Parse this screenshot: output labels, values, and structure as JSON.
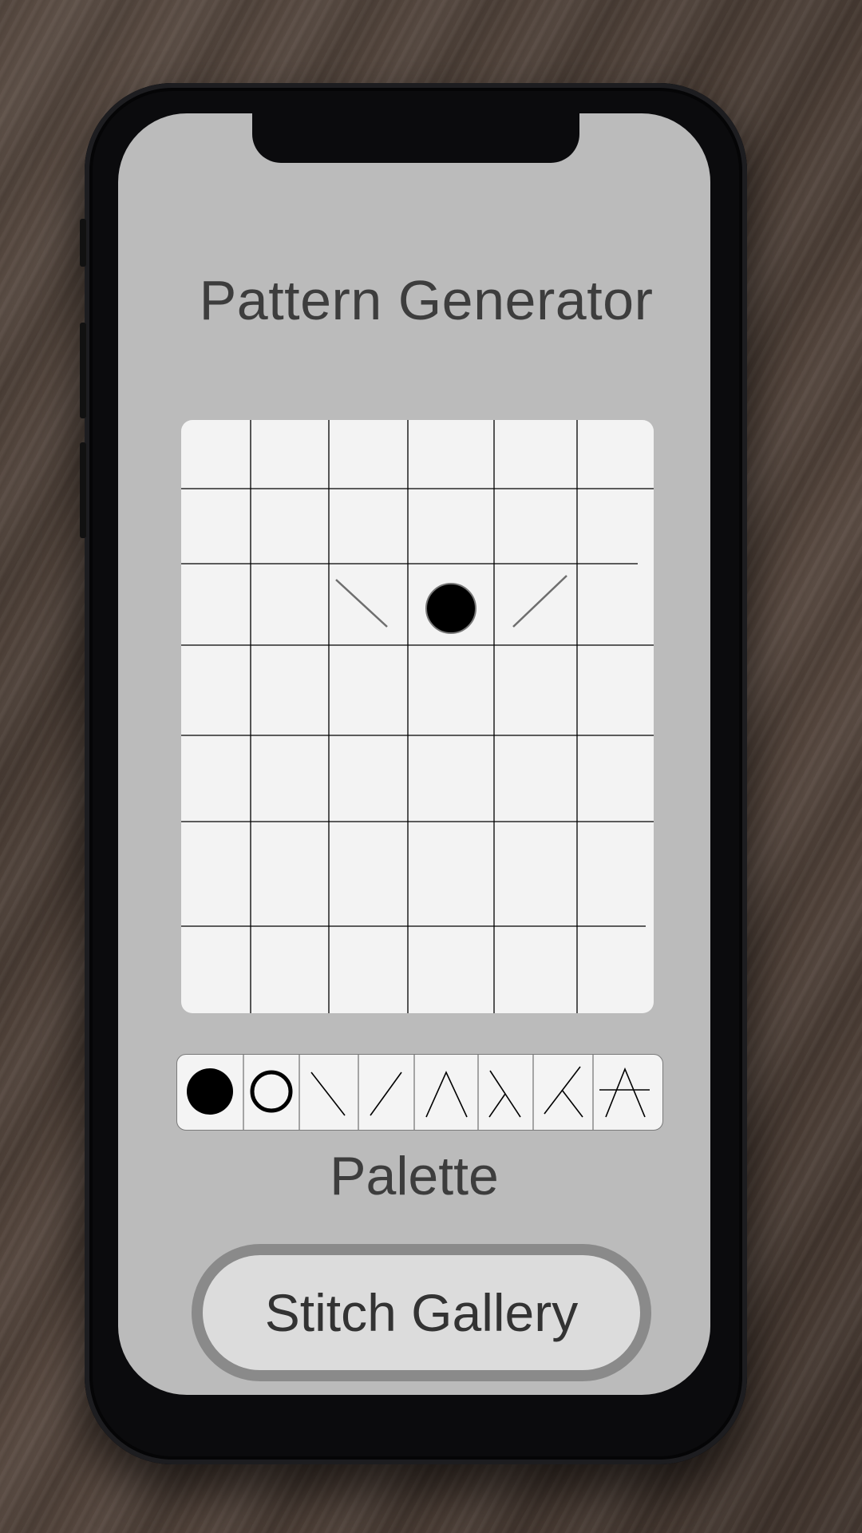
{
  "app": {
    "title": "Pattern Generator"
  },
  "pattern_grid": {
    "columns": 6,
    "rows": 7,
    "symbols": [
      {
        "row": 3,
        "col": 3,
        "symbol": "backslash-stitch-icon"
      },
      {
        "row": 3,
        "col": 4,
        "symbol": "filled-circle-icon"
      },
      {
        "row": 3,
        "col": 5,
        "symbol": "slash-stitch-icon"
      }
    ]
  },
  "palette": {
    "label": "Palette",
    "items": [
      {
        "name": "filled-circle-icon"
      },
      {
        "name": "open-circle-icon"
      },
      {
        "name": "backslash-stitch-icon"
      },
      {
        "name": "slash-stitch-icon"
      },
      {
        "name": "caret-stitch-icon"
      },
      {
        "name": "lambda-stitch-icon"
      },
      {
        "name": "k-stitch-icon"
      },
      {
        "name": "crossed-caret-stitch-icon"
      }
    ]
  },
  "actions": {
    "gallery_label": "Stitch Gallery"
  },
  "colors": {
    "screen_bg": "#bbbbbb",
    "panel_bg": "#f3f3f3",
    "text": "#3d3d3d",
    "button_border": "#8a8a8a"
  }
}
